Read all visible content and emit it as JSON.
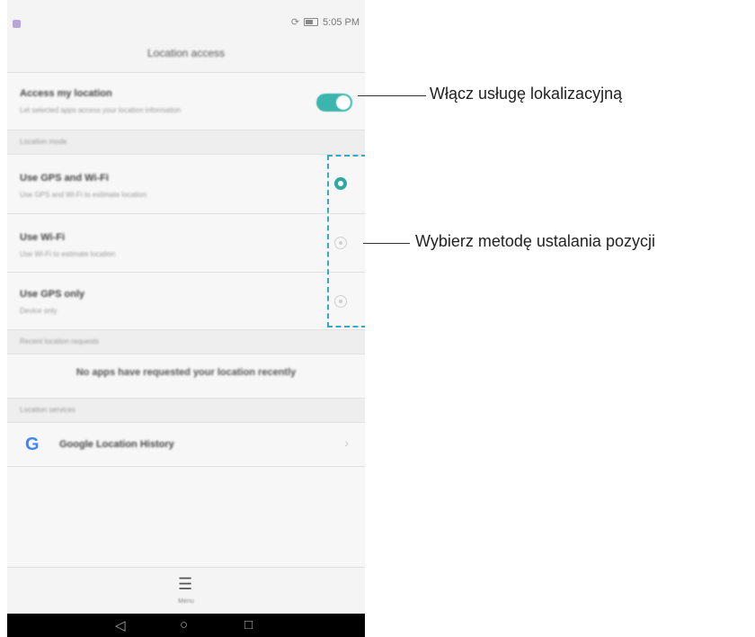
{
  "status_bar": {
    "time": "5:05 PM"
  },
  "header": {
    "title": "Location access"
  },
  "access_row": {
    "title": "Access my location",
    "subtitle": "Let selected apps access your location information",
    "enabled": true
  },
  "sections": {
    "location_mode": "Location mode",
    "recent_requests": "Recent location requests",
    "location_services": "Location services"
  },
  "modes": [
    {
      "title": "Use GPS and Wi-Fi",
      "subtitle": "Use GPS and Wi-Fi to estimate location",
      "selected": true
    },
    {
      "title": "Use Wi-Fi",
      "subtitle": "Use Wi-Fi to estimate location",
      "selected": false
    },
    {
      "title": "Use GPS only",
      "subtitle": "Device only",
      "selected": false
    }
  ],
  "recent": {
    "empty_text": "No apps have requested your location recently"
  },
  "services": {
    "google_history": "Google Location History"
  },
  "bottom": {
    "menu_label": "Menu"
  },
  "callouts": {
    "enable": "Włącz usługę lokalizacyjną",
    "choose": "Wybierz metodę ustalania pozycji"
  },
  "colors": {
    "accent": "#3bb5ad",
    "dashed_box": "#3aa7c9"
  }
}
